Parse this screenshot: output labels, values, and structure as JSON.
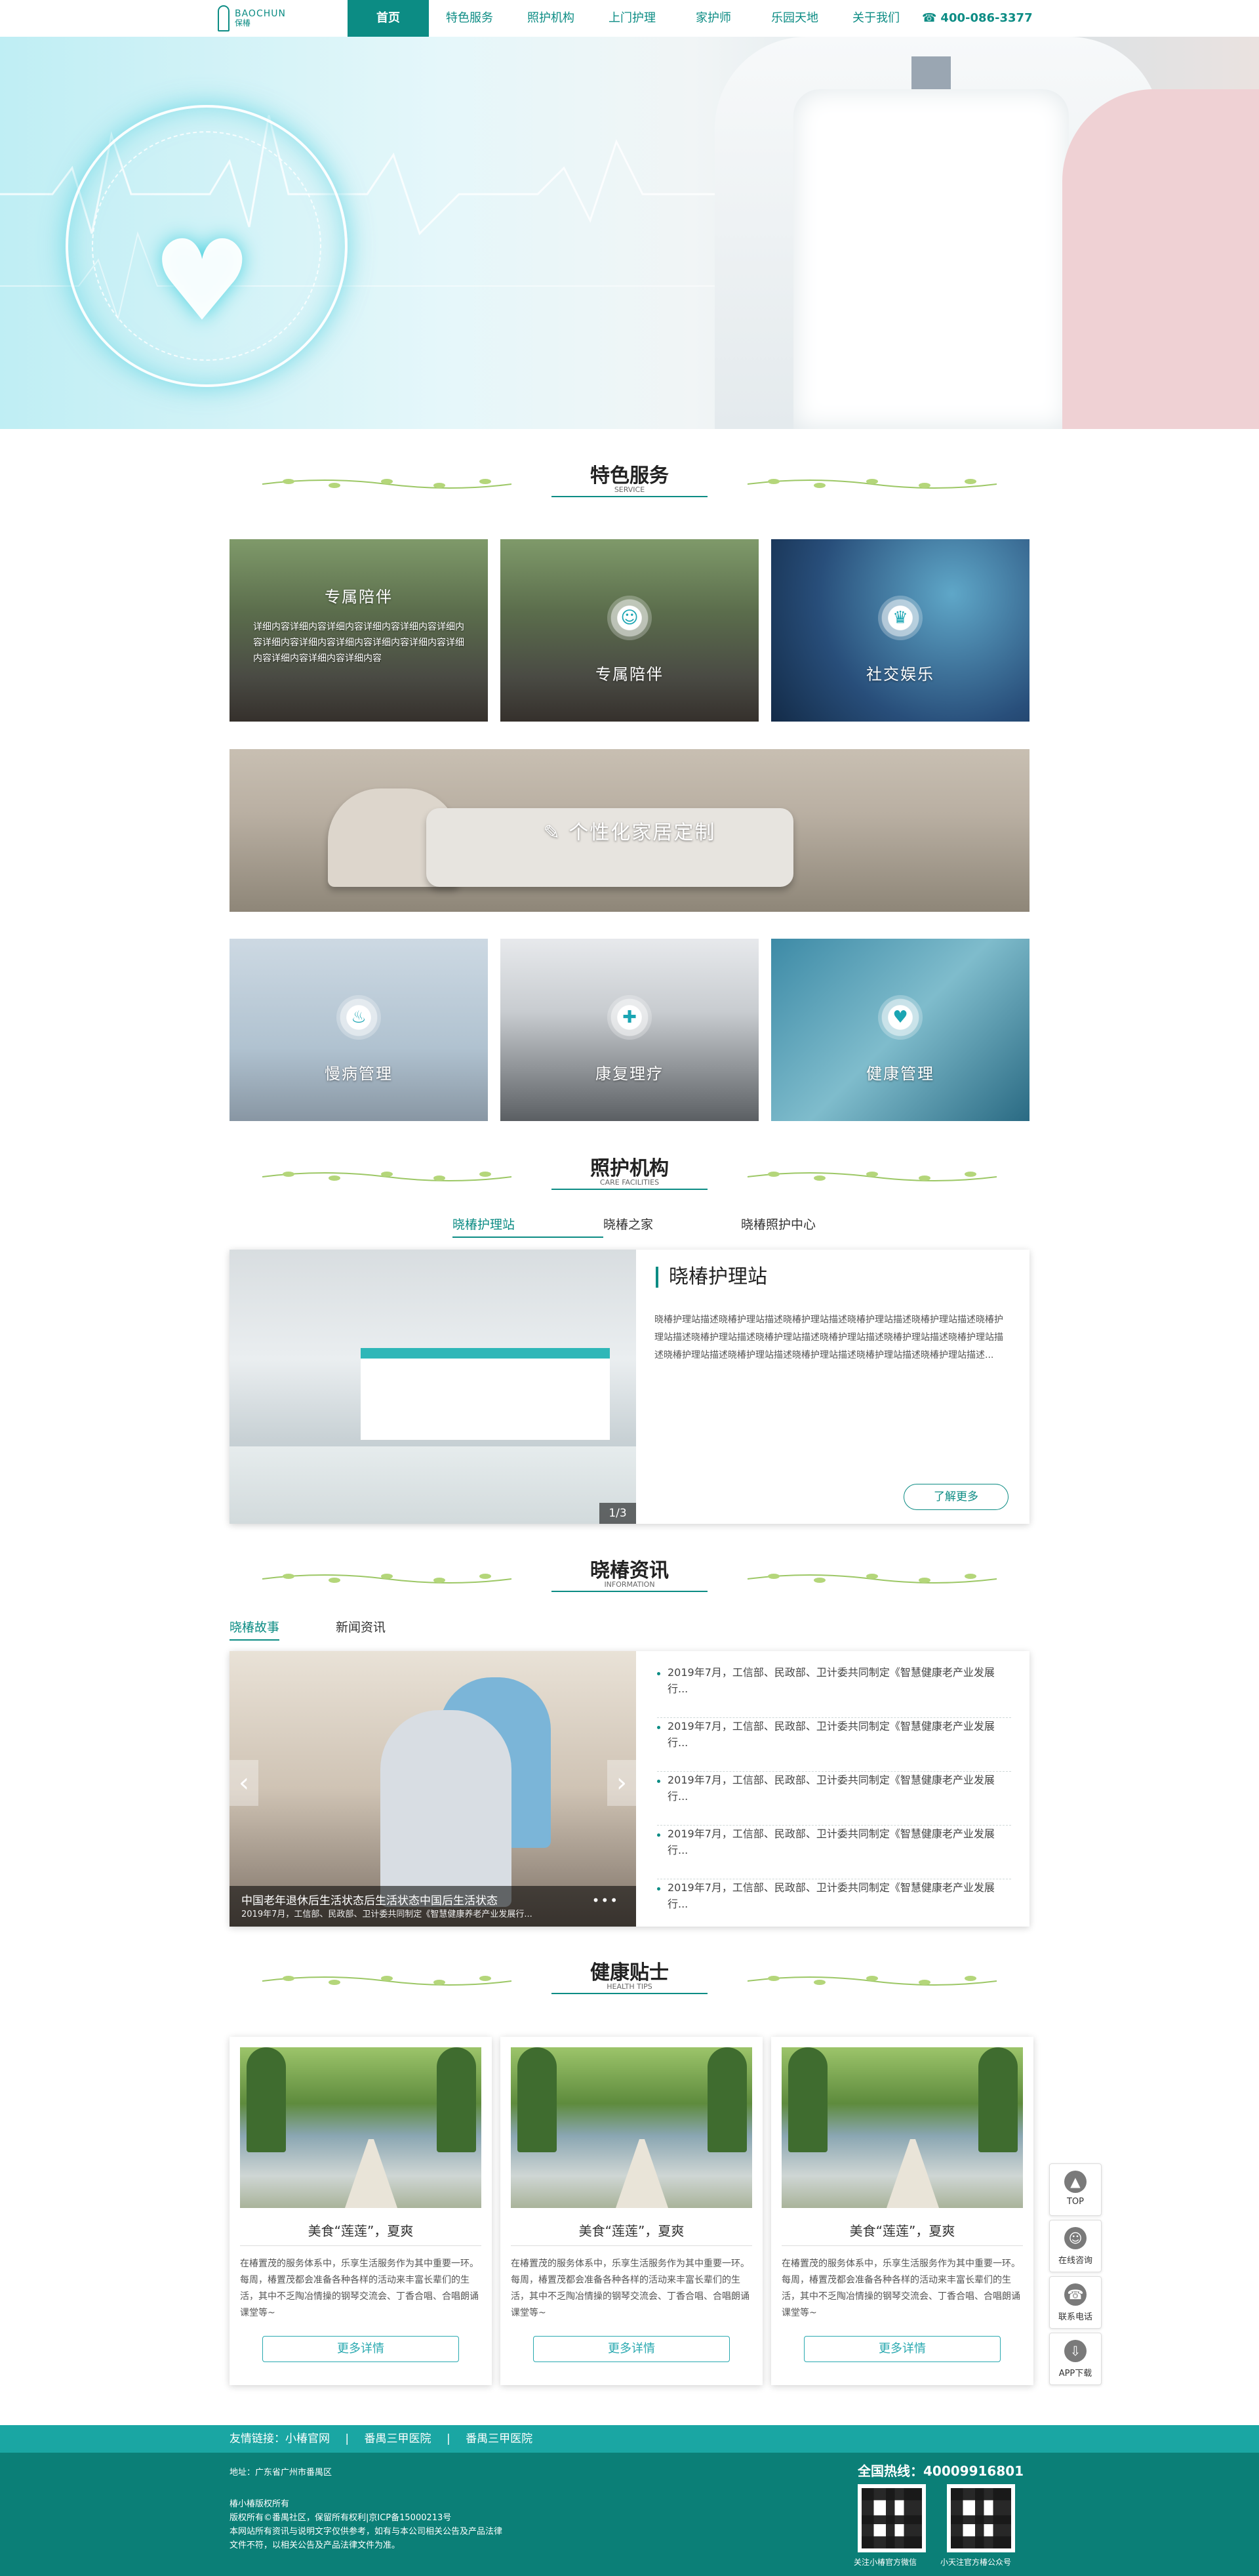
{
  "nav": {
    "logo_en": "BAOCHUN",
    "logo_cn": "保椿",
    "items": [
      "首页",
      "特色服务",
      "照护机构",
      "上门护理",
      "家护师",
      "乐园天地",
      "关于我们"
    ],
    "phone": "400-086-3377"
  },
  "hero": {
    "dots": 3
  },
  "services": {
    "title": "特色服务",
    "subtitle": "SERVICE",
    "cards": [
      {
        "title": "专属陪伴",
        "desc": "详细内容详细内容详细内容详细内容详细内容详细内容详细内容详细内容详细内容详细内容详细内容详细内容详细内容详细内容详细内容"
      },
      {
        "title": "专属陪伴"
      },
      {
        "title": "社交娱乐"
      },
      {
        "title": "个性化家居定制"
      },
      {
        "title": "慢病管理"
      },
      {
        "title": "康复理疗"
      },
      {
        "title": "健康管理"
      }
    ]
  },
  "care": {
    "title": "照护机构",
    "subtitle": "CARE FACILITIES",
    "tabs": [
      "晓椿护理站",
      "晓椿之家",
      "晓椿照护中心"
    ],
    "item_title": "晓椿护理站",
    "item_text": "晓椿护理站描述晓椿护理站描述晓椿护理站描述晓椿护理站描述晓椿护理站描述晓椿护理站描述晓椿护理站描述晓椿护理站描述晓椿护理站描述晓椿护理站描述晓椿护理站描述晓椿护理站描述晓椿护理站描述晓椿护理站描述晓椿护理站描述晓椿护理站描述...",
    "pager": "1/3",
    "more": "了解更多"
  },
  "news": {
    "title": "晓椿资讯",
    "subtitle": "INFORMATION",
    "tabs": [
      "晓椿故事",
      "新闻资讯"
    ],
    "caption_title": "中国老年退休后生活状态后生活状态中国后生活状态",
    "caption_sub": "2019年7月，工信部、民政部、卫计委共同制定《智慧健康养老产业发展行...",
    "more_dots": "•••",
    "prev": "‹",
    "next": "›",
    "items": [
      "2019年7月，工信部、民政部、卫计委共同制定《智慧健康老产业发展行...",
      "2019年7月，工信部、民政部、卫计委共同制定《智慧健康老产业发展行...",
      "2019年7月，工信部、民政部、卫计委共同制定《智慧健康老产业发展行...",
      "2019年7月，工信部、民政部、卫计委共同制定《智慧健康老产业发展行...",
      "2019年7月，工信部、民政部、卫计委共同制定《智慧健康老产业发展行..."
    ]
  },
  "tips": {
    "title": "健康贴士",
    "subtitle": "HEALTH TIPS",
    "cards": [
      {
        "name": "美食“莲莲”，夏爽",
        "text": "在椿置茂的服务体系中，乐享生活服务作为其中重要一环。每周，椿置茂都会准备各种各样的活动来丰富长辈们的生活，其中不乏陶冶情操的钢琴交流会、丁香合唱、合唱朗诵课堂等~",
        "more": "更多详情"
      },
      {
        "name": "美食“莲莲”，夏爽",
        "text": "在椿置茂的服务体系中，乐享生活服务作为其中重要一环。每周，椿置茂都会准备各种各样的活动来丰富长辈们的生活，其中不乏陶冶情操的钢琴交流会、丁香合唱、合唱朗诵课堂等~",
        "more": "更多详情"
      },
      {
        "name": "美食“莲莲”，夏爽",
        "text": "在椿置茂的服务体系中，乐享生活服务作为其中重要一环。每周，椿置茂都会准备各种各样的活动来丰富长辈们的生活，其中不乏陶冶情操的钢琴交流会、丁香合唱、合唱朗诵课堂等~",
        "more": "更多详情"
      }
    ]
  },
  "side": [
    "TOP",
    "在线咨询",
    "联系电话",
    "APP下载"
  ],
  "footer": {
    "links_label": "友情链接：小椿官网",
    "link2": "番禺三甲医院",
    "link3": "番禺三甲医院",
    "sep": "|",
    "address": "地址：广东省广州市番禺区",
    "lines": [
      "椿小椿版权所有",
      "版权所有©番禺社区，保留所有权利|京ICP备15000213号",
      "本网站所有资讯与说明文字仅供参考，如有与本公司相关公告及产品法律",
      "文件不符，以相关公告及产品法律文件为准。"
    ],
    "hotline": "全国热线：40009916801",
    "qr1": "关注小椿官方微信",
    "qr2": "小天注官方椿公众号"
  },
  "colors": {
    "primary": "#0c8c84",
    "footer": "#0b7f77",
    "link_bar": "#1aa6a3"
  }
}
